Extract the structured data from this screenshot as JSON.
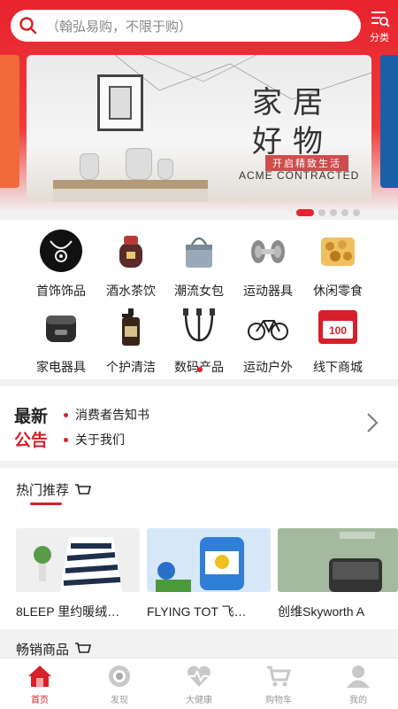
{
  "search": {
    "placeholder": "（翰弘易购，不限于购）",
    "category_label": "分类"
  },
  "banner": {
    "title_line1": "家居",
    "title_line2": "好物",
    "subtitle": "开启精致生活",
    "english": "ACME CONTRACTED",
    "slide_count": 5,
    "active_slide": 1
  },
  "categories": [
    {
      "label": "首饰饰品",
      "icon": "jewelry-icon"
    },
    {
      "label": "酒水茶饮",
      "icon": "liquor-jar-icon"
    },
    {
      "label": "潮流女包",
      "icon": "handbag-icon"
    },
    {
      "label": "运动器具",
      "icon": "dumbbell-icon"
    },
    {
      "label": "休闲零食",
      "icon": "snack-icon"
    },
    {
      "label": "家电器具",
      "icon": "rice-cooker-icon"
    },
    {
      "label": "个护清洁",
      "icon": "shampoo-bottle-icon"
    },
    {
      "label": "数码产品",
      "icon": "cable-icon"
    },
    {
      "label": "运动户外",
      "icon": "bicycle-icon"
    },
    {
      "label": "线下商城",
      "icon": "voucher-icon"
    }
  ],
  "voucher_value": "100",
  "notice": {
    "title_line1": "最新",
    "title_line2": "公告",
    "items": [
      "消费者告知书",
      "关于我们"
    ]
  },
  "hot": {
    "title": "热门推荐",
    "products": [
      {
        "name": "8LEEP 里约暖绒…"
      },
      {
        "name": "FLYING TOT 飞…"
      },
      {
        "name": "创维Skyworth A"
      }
    ]
  },
  "next_section_title": "畅销商品",
  "nav": [
    {
      "label": "首页",
      "icon": "home-icon",
      "active": true
    },
    {
      "label": "发现",
      "icon": "discover-icon",
      "active": false
    },
    {
      "label": "大健康",
      "icon": "health-icon",
      "active": false
    },
    {
      "label": "购物车",
      "icon": "cart-icon",
      "active": false
    },
    {
      "label": "我的",
      "icon": "profile-icon",
      "active": false
    }
  ],
  "colors": {
    "brand_red": "#e8232f",
    "accent_red": "#d6202a"
  }
}
